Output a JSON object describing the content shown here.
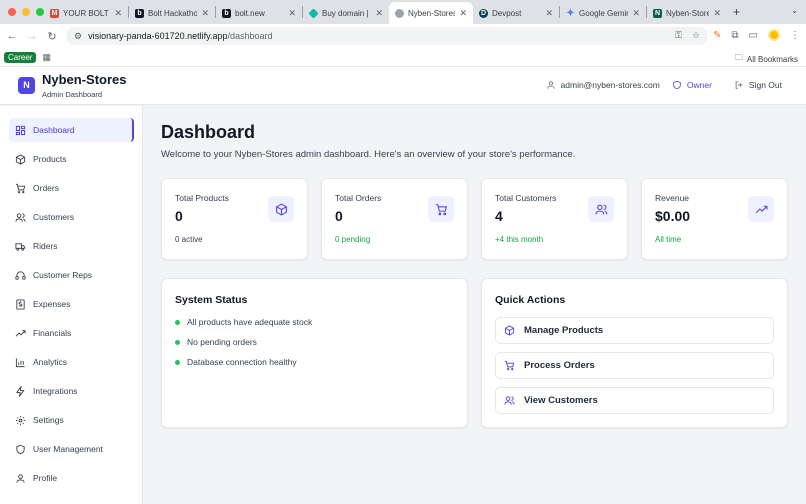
{
  "browser": {
    "tabs": [
      {
        "label": "YOUR BOLT B...",
        "icon": "gmail-icon",
        "color": "#ea4335"
      },
      {
        "label": "Bolt Hackathon",
        "icon": "bolt-icon",
        "color": "#111827"
      },
      {
        "label": "bolt.new",
        "icon": "bolt-icon",
        "color": "#111827"
      },
      {
        "label": "Buy domain | E...",
        "icon": "diamond-icon",
        "color": "#14b8a6"
      },
      {
        "label": "Nyben-Stores",
        "icon": "globe-icon",
        "color": "#9ca3af"
      },
      {
        "label": "Devpost",
        "icon": "devpost-icon",
        "color": "#003e54"
      },
      {
        "label": "Google Gemini",
        "icon": "gemini-icon",
        "color": "#4285f4"
      },
      {
        "label": "Nyben-Store |",
        "icon": "nyben-icon",
        "color": "#065f46"
      }
    ],
    "active_tab_index": 4,
    "url_host": "visionary-panda-601720.netlify.app",
    "url_path": "/dashboard",
    "bookmark_chip": "Career",
    "all_bookmarks": "All Bookmarks"
  },
  "header": {
    "logo_letter": "N",
    "brand": "Nyben-Stores",
    "subtitle": "Admin Dashboard",
    "user_email": "admin@nyben-stores.com",
    "role": "Owner",
    "sign_out": "Sign Out"
  },
  "sidebar": {
    "items": [
      {
        "label": "Dashboard",
        "icon": "dashboard-icon",
        "active": true
      },
      {
        "label": "Products",
        "icon": "package-icon"
      },
      {
        "label": "Orders",
        "icon": "cart-icon"
      },
      {
        "label": "Customers",
        "icon": "users-icon"
      },
      {
        "label": "Riders",
        "icon": "truck-icon"
      },
      {
        "label": "Customer Reps",
        "icon": "headset-icon"
      },
      {
        "label": "Expenses",
        "icon": "receipt-icon"
      },
      {
        "label": "Financials",
        "icon": "trend-icon"
      },
      {
        "label": "Analytics",
        "icon": "bar-chart-icon"
      },
      {
        "label": "Integrations",
        "icon": "zap-icon"
      },
      {
        "label": "Settings",
        "icon": "gear-icon"
      },
      {
        "label": "User Management",
        "icon": "shield-icon"
      },
      {
        "label": "Profile",
        "icon": "user-icon"
      }
    ]
  },
  "main": {
    "title": "Dashboard",
    "subtitle": "Welcome to your Nyben-Stores admin dashboard. Here's an overview of your store's performance.",
    "stats": [
      {
        "label": "Total Products",
        "value": "0",
        "footer": "0 active",
        "icon": "package-icon"
      },
      {
        "label": "Total Orders",
        "value": "0",
        "footer": "0 pending",
        "icon": "cart-icon"
      },
      {
        "label": "Total Customers",
        "value": "4",
        "footer": "+4 this month",
        "icon": "users-icon"
      },
      {
        "label": "Revenue",
        "value": "$0.00",
        "footer": "All time",
        "icon": "trend-icon"
      }
    ],
    "system_status": {
      "title": "System Status",
      "items": [
        "All products have adequate stock",
        "No pending orders",
        "Database connection healthy"
      ]
    },
    "quick_actions": {
      "title": "Quick Actions",
      "items": [
        {
          "label": "Manage Products",
          "icon": "package-icon"
        },
        {
          "label": "Process Orders",
          "icon": "cart-icon"
        },
        {
          "label": "View Customers",
          "icon": "users-icon"
        }
      ]
    }
  },
  "colors": {
    "accent": "#4f46e5",
    "accent_bg": "#eef2ff",
    "success": "#16a34a"
  }
}
